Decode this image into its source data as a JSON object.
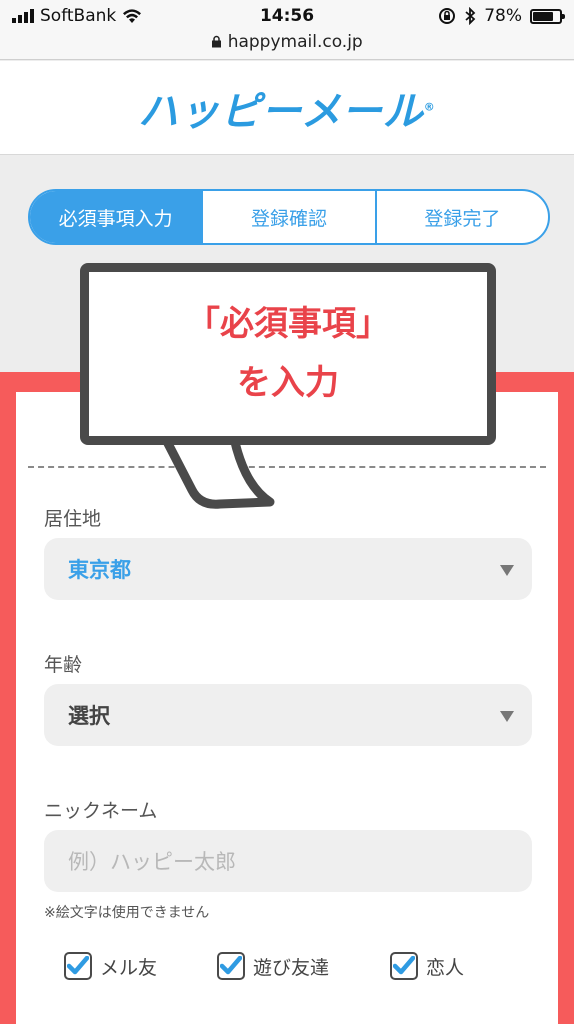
{
  "status": {
    "carrier": "SoftBank",
    "time": "14:56",
    "battery": "78%",
    "battery_level": 0.78,
    "url": "happymail.co.jp"
  },
  "header": {
    "logo": "ハッピーメール",
    "logo_mark": "®"
  },
  "steps": [
    "必須事項入力",
    "登録確認",
    "登録完了"
  ],
  "callout": {
    "line1": "「必須事項」",
    "line2": "を入力"
  },
  "form": {
    "residence_label": "居住地",
    "residence_value": "東京都",
    "age_label": "年齢",
    "age_value": "選択",
    "nickname_label": "ニックネーム",
    "nickname_placeholder": "例）ハッピー太郎",
    "nickname_note": "※絵文字は使用できません",
    "purposes": [
      "メル友",
      "遊び友達",
      "恋人"
    ]
  },
  "colors": {
    "accent": "#3aa0e8",
    "highlight": "#f65b5b",
    "callout_text": "#e9434a",
    "callout_border": "#4a4a4a",
    "selected_value": "#3aa0e8"
  }
}
